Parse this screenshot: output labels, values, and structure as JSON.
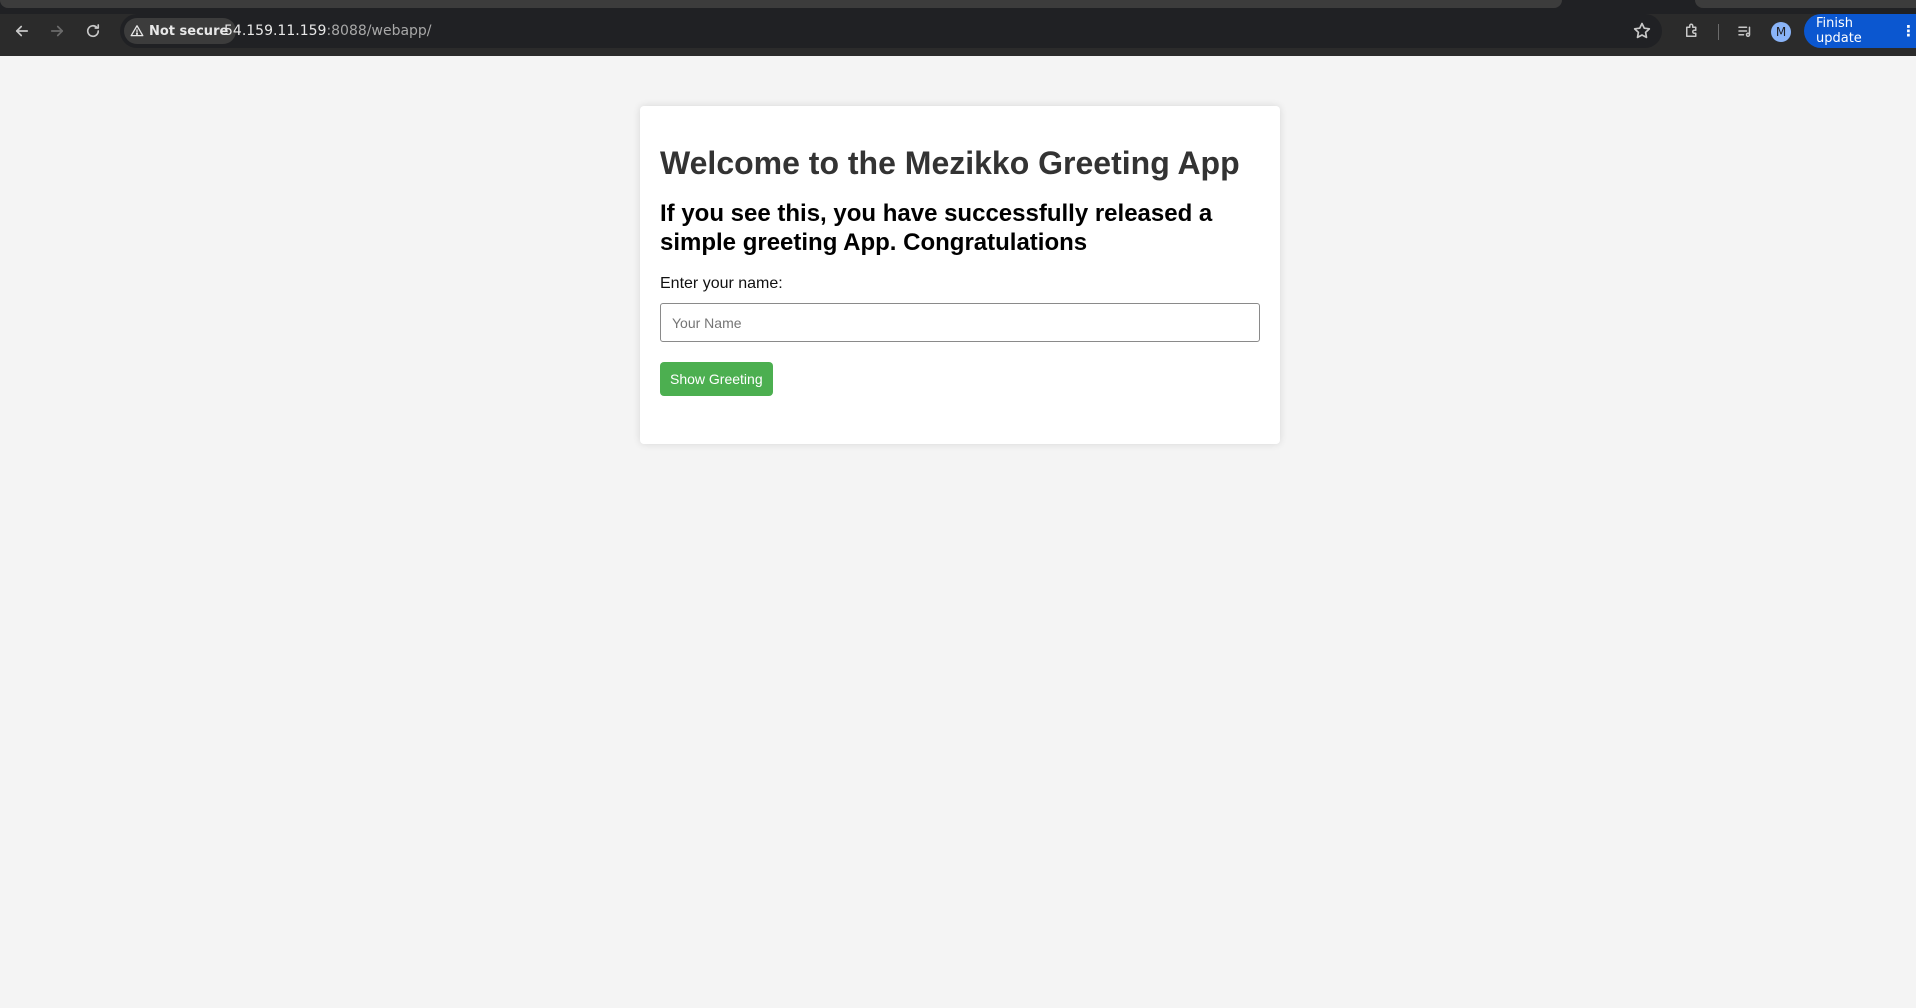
{
  "browser": {
    "security_label": "Not secure",
    "url_host": "54.159.11.159",
    "url_rest": ":8088/webapp/",
    "profile_initial": "M",
    "update_label": "Finish update",
    "update_color": "#0b57d0"
  },
  "page": {
    "title": "Welcome to the Mezikko Greeting App",
    "subtitle": "If you see this, you have successfully released a simple greeting App. Congratulations",
    "name_label": "Enter your name:",
    "name_placeholder": "Your Name",
    "name_value": "",
    "button_label": "Show Greeting",
    "button_color": "#4caf50"
  },
  "icons": {
    "back": "arrow-left-icon",
    "forward": "arrow-right-icon",
    "reload": "reload-icon",
    "warning": "warning-triangle-icon",
    "bookmark": "star-icon",
    "extensions": "puzzle-icon",
    "media": "media-control-icon",
    "menu": "kebab-icon"
  }
}
